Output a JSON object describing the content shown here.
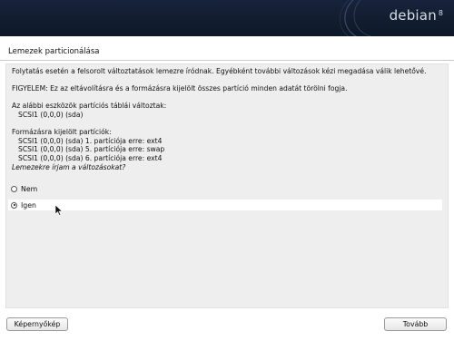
{
  "banner": {
    "brand": "debian",
    "version": "8"
  },
  "page": {
    "title": "Lemezek particionálása"
  },
  "content": {
    "intro": "Folytatás esetén a felsorolt változtatások lemezre íródnak. Egyébként további változások kézi megadása válik lehetővé.",
    "warning": "FIGYELEM: Ez az eltávolításra és a formázásra kijelölt összes partíció minden adatát törölni fogja.",
    "table_heading": "Az alábbi eszközök partíciós táblái változtak:",
    "table_items": [
      "SCSI1 (0,0,0) (sda)"
    ],
    "format_heading": "Formázásra kijelölt partíciók:",
    "format_items": [
      "SCSI1 (0,0,0) (sda) 1. partíciója erre: ext4",
      "SCSI1 (0,0,0) (sda) 5. partíciója erre: swap",
      "SCSI1 (0,0,0) (sda) 6. partíciója erre: ext4"
    ],
    "question": "Lemezekre írjam a változásokat?"
  },
  "options": [
    {
      "label": "Nem",
      "selected": false
    },
    {
      "label": "Igen",
      "selected": true
    }
  ],
  "buttons": {
    "screenshot": "Képernyőkép",
    "continue": "Tovább"
  }
}
